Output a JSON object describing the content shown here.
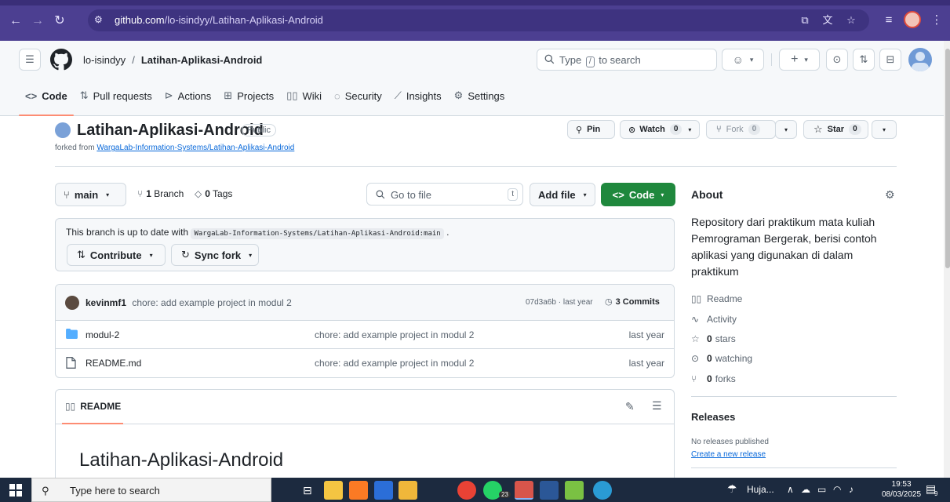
{
  "browser": {
    "url_host": "github.com",
    "url_path": "/lo-isindyy/Latihan-Aplikasi-Android"
  },
  "header": {
    "owner": "lo-isindyy",
    "separator": "/",
    "repo": "Latihan-Aplikasi-Android",
    "search_prefix": "Type",
    "search_key": "/",
    "search_suffix": "to search"
  },
  "tabs": [
    {
      "label": "Code",
      "icon": "code-icon"
    },
    {
      "label": "Pull requests",
      "icon": "pull-request-icon"
    },
    {
      "label": "Actions",
      "icon": "play-icon"
    },
    {
      "label": "Projects",
      "icon": "table-icon"
    },
    {
      "label": "Wiki",
      "icon": "book-icon"
    },
    {
      "label": "Security",
      "icon": "shield-icon"
    },
    {
      "label": "Insights",
      "icon": "graph-icon"
    },
    {
      "label": "Settings",
      "icon": "gear-icon"
    }
  ],
  "repo": {
    "title": "Latihan-Aplikasi-Android",
    "visibility": "Public",
    "forked_prefix": "forked from",
    "forked_source": "WargaLab-Information-Systems/Latihan-Aplikasi-Android",
    "pin": "Pin",
    "watch": "Watch",
    "watch_count": "0",
    "fork": "Fork",
    "fork_count": "0",
    "star": "Star",
    "star_count": "0"
  },
  "branchbar": {
    "branch": "main",
    "branches_count": "1",
    "branches_label": "Branch",
    "tags_count": "0",
    "tags_label": "Tags",
    "goto_placeholder": "Go to file",
    "goto_key": "t",
    "add_file": "Add file",
    "code": "Code"
  },
  "status": {
    "message_prefix": "This branch is up to date with",
    "ref": "WargaLab-Information-Systems/Latihan-Aplikasi-Android:main",
    "message_suffix": ".",
    "contribute": "Contribute",
    "sync_fork": "Sync fork"
  },
  "commit": {
    "author": "kevinmf1",
    "message": "chore: add example project in modul 2",
    "hash": "07d3a6b",
    "dot": "·",
    "time": "last year",
    "commits_count": "3",
    "commits_label": "Commits"
  },
  "files": [
    {
      "name": "modul-2",
      "type": "folder",
      "message": "chore: add example project in modul 2",
      "date": "last year"
    },
    {
      "name": "README.md",
      "type": "file",
      "message": "chore: add example project in modul 2",
      "date": "last year"
    }
  ],
  "readme": {
    "tab_label": "README",
    "heading": "Latihan-Aplikasi-Android"
  },
  "about": {
    "heading": "About",
    "description": "Repository dari praktikum mata kuliah Pemrograman Bergerak, berisi contoh aplikasi yang digunakan di dalam praktikum",
    "readme": "Readme",
    "activity": "Activity",
    "stars_count": "0",
    "stars_label": "stars",
    "watching_count": "0",
    "watching_label": "watching",
    "forks_count": "0",
    "forks_label": "forks",
    "releases_heading": "Releases",
    "no_releases": "No releases published",
    "create_release": "Create a new release"
  },
  "taskbar": {
    "search_placeholder": "Type here to search",
    "weather": "Huja...",
    "time": "19:53",
    "date": "08/03/2025",
    "badge_whatsapp": "23",
    "notif_count": "9"
  },
  "colors": {
    "browser_frame": "#4c3f91",
    "accent_green": "#1f883d",
    "link_blue": "#0969da",
    "tab_underline": "#fd8c73",
    "taskbar": "#1c2a3f"
  }
}
